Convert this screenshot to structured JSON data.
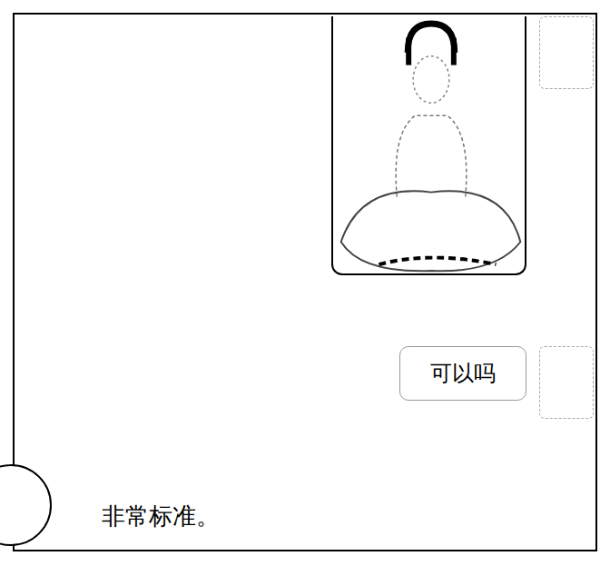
{
  "messages": [
    {
      "kind": "image",
      "from": "me"
    },
    {
      "kind": "text",
      "from": "me",
      "text": "可以吗"
    },
    {
      "kind": "text",
      "from": "other",
      "text": "非常标准。"
    }
  ]
}
